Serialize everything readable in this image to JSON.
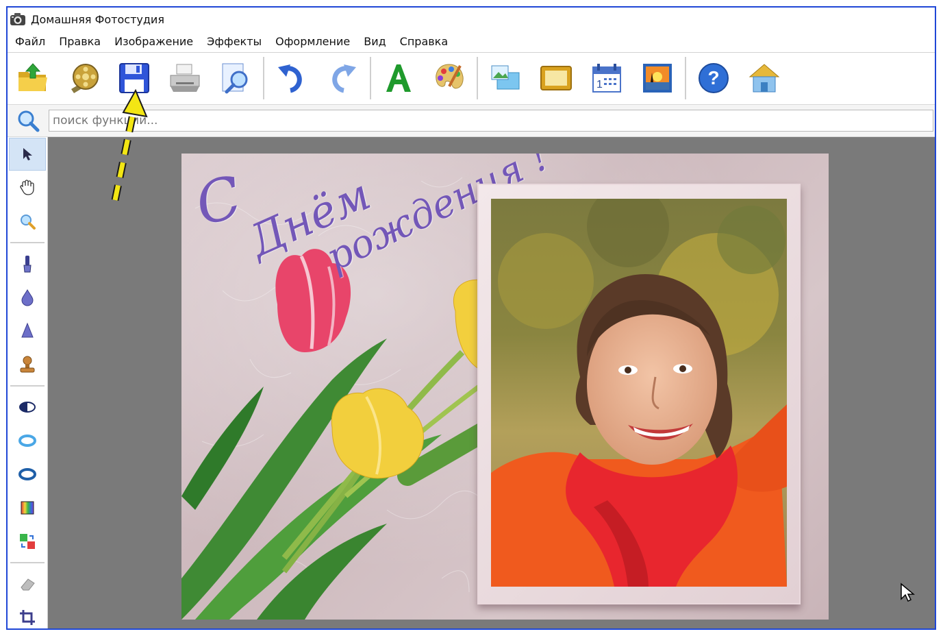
{
  "window": {
    "title": "Домашняя Фотостудия",
    "border_color": "#1f47d6"
  },
  "menu": {
    "items": [
      "Файл",
      "Правка",
      "Изображение",
      "Эффекты",
      "Оформление",
      "Вид",
      "Справка"
    ]
  },
  "toolbar": {
    "buttons": [
      {
        "icon": "open-folder-icon"
      },
      {
        "icon": "film-reel-icon"
      },
      {
        "icon": "save-floppy-icon"
      },
      {
        "icon": "printer-icon"
      },
      {
        "icon": "preview-magnifier-icon"
      },
      {
        "icon": "undo-arrow-icon"
      },
      {
        "icon": "redo-arrow-icon"
      },
      {
        "icon": "text-a-icon"
      },
      {
        "icon": "palette-icon"
      },
      {
        "icon": "picture-in-picture-icon"
      },
      {
        "icon": "frame-icon"
      },
      {
        "icon": "calendar-icon"
      },
      {
        "icon": "postcard-sunset-icon"
      },
      {
        "icon": "help-icon"
      },
      {
        "icon": "home-icon"
      }
    ]
  },
  "search": {
    "placeholder": "поиск функции..."
  },
  "sidebar": {
    "tools": [
      {
        "icon": "pointer-arrow-icon",
        "active": true
      },
      {
        "icon": "hand-pan-icon"
      },
      {
        "icon": "zoom-icon"
      },
      {
        "icon": "brush-icon"
      },
      {
        "icon": "blur-drop-icon"
      },
      {
        "icon": "sharpen-cone-icon"
      },
      {
        "icon": "clone-stamp-icon"
      },
      {
        "icon": "contrast-oval-icon"
      },
      {
        "icon": "light-ring-icon"
      },
      {
        "icon": "dark-ring-icon"
      },
      {
        "icon": "gradient-fill-icon"
      },
      {
        "icon": "color-swap-icon"
      },
      {
        "icon": "eraser-icon"
      },
      {
        "icon": "crop-icon"
      }
    ]
  },
  "card": {
    "greeting_line1": "С",
    "greeting_line2": "Днём",
    "greeting_line3": "рождения !"
  },
  "colors": {
    "canvas_bg": "#7a7a7a",
    "greeting_text": "#7357b8",
    "annotation_arrow": "#f3e614"
  }
}
